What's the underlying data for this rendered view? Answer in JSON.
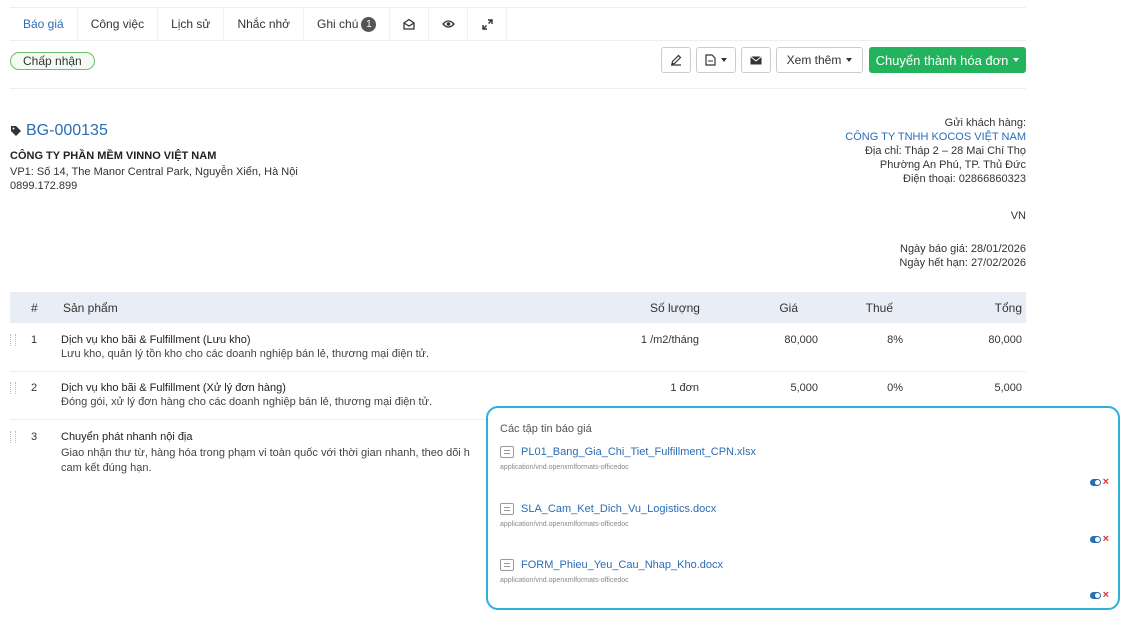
{
  "tabs": [
    {
      "label": "Báo giá",
      "active": true
    },
    {
      "label": "Công việc"
    },
    {
      "label": "Lịch sử"
    },
    {
      "label": "Nhắc nhở"
    },
    {
      "label": "Ghi chú",
      "badge": "1"
    }
  ],
  "tab_icons": [
    "envelope-open-icon",
    "eye-icon",
    "expand-icon"
  ],
  "status": "Chấp nhận",
  "toolbar": {
    "more_label": "Xem thêm",
    "convert_label": "Chuyển thành hóa đơn"
  },
  "quote": {
    "number": "BG-000135",
    "company": "CÔNG TY PHẦN MỀM VINNO VIỆT NAM",
    "address": "VP1: Số 14, The Manor Central Park, Nguyễn Xiển, Hà Nội",
    "phone": "0899.172.899"
  },
  "customer": {
    "heading": "Gửi khách hàng:",
    "name": "CÔNG TY TNHH KOCOS VIỆT NAM",
    "address1": "Địa chỉ: Tháp 2 – 28 Mai Chí Thọ",
    "address2": "Phường An Phú, TP. Thủ Đức",
    "phone": "Điện thoại: 02866860323",
    "country": "VN",
    "quote_date": "Ngày báo giá: 28/01/2026",
    "expiry_date": "Ngày hết hạn: 27/02/2026"
  },
  "table": {
    "headers": {
      "no": "#",
      "product": "Sản phẩm",
      "qty": "Số lượng",
      "price": "Giá",
      "tax": "Thuế",
      "total": "Tổng"
    },
    "rows": [
      {
        "no": "1",
        "title": "Dịch vụ kho bãi & Fulfillment (Lưu kho)",
        "desc": "Lưu kho, quản lý tồn kho cho các doanh nghiệp bán lẻ, thương mại điện tử.",
        "qty": "1 /m2/tháng",
        "price": "80,000",
        "tax": "8%",
        "total": "80,000"
      },
      {
        "no": "2",
        "title": "Dịch vụ kho bãi & Fulfillment (Xử lý đơn hàng)",
        "desc": "Đóng gói, xử lý đơn hàng cho các doanh nghiệp bán lẻ, thương mại điện tử.",
        "qty": "1 đơn",
        "price": "5,000",
        "tax": "0%",
        "total": "5,000"
      },
      {
        "no": "3",
        "title": "Chuyển phát nhanh nội địa",
        "desc1": "Giao nhận thư từ, hàng hóa trong phạm vi toàn quốc với thời gian nhanh, theo dõi h",
        "desc2": "cam kết đúng hạn."
      }
    ]
  },
  "attachments": {
    "title": "Các tập tin báo giá",
    "files": [
      {
        "name": "PL01_Bang_Gia_Chi_Tiet_Fulfillment_CPN.xlsx",
        "mime": "application/vnd.openxmlformats-officedoc"
      },
      {
        "name": "SLA_Cam_Ket_Dich_Vu_Logistics.docx",
        "mime": "application/vnd.openxmlformats-officedoc"
      },
      {
        "name": "FORM_Phieu_Yeu_Cau_Nhap_Kho.docx",
        "mime": "application/vnd.openxmlformats-officedoc"
      }
    ]
  },
  "colors": {
    "accent": "#2a6db5",
    "success": "#22b35c",
    "panel_border": "#2bb0d9",
    "delete": "#e03030"
  }
}
